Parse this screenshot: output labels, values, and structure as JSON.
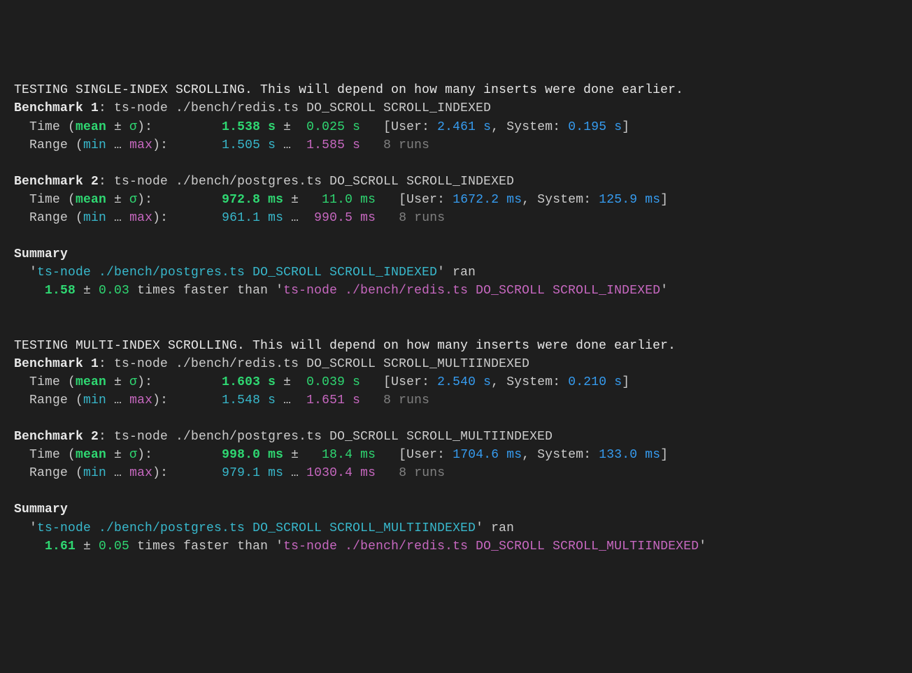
{
  "sections": [
    {
      "header": "TESTING SINGLE-INDEX SCROLLING. This will depend on how many inserts were done earlier.",
      "benchmarks": [
        {
          "label": "Benchmark 1",
          "cmd": "ts-node ./bench/redis.ts DO_SCROLL SCROLL_INDEXED",
          "mean": "1.538",
          "mean_unit": "s",
          "stddev": "0.025",
          "stddev_unit": "s",
          "user": "2.461",
          "user_unit": "s",
          "system": "0.195",
          "system_unit": "s",
          "min": "1.505",
          "min_unit": "s",
          "max": "1.585",
          "max_unit": "s",
          "runs": "8 runs"
        },
        {
          "label": "Benchmark 2",
          "cmd": "ts-node ./bench/postgres.ts DO_SCROLL SCROLL_INDEXED",
          "mean": "972.8",
          "mean_unit": "ms",
          "stddev": "11.0",
          "stddev_unit": "ms",
          "user": "1672.2",
          "user_unit": "ms",
          "system": "125.9",
          "system_unit": "ms",
          "min": "961.1",
          "min_unit": "ms",
          "max": "990.5",
          "max_unit": "ms",
          "runs": "8 runs"
        }
      ],
      "summary": {
        "winner": "ts-node ./bench/postgres.ts DO_SCROLL SCROLL_INDEXED",
        "ran": " ran",
        "factor": "1.58",
        "factor_pm": "0.03",
        "loser": "ts-node ./bench/redis.ts DO_SCROLL SCROLL_INDEXED"
      }
    },
    {
      "header": "TESTING MULTI-INDEX SCROLLING. This will depend on how many inserts were done earlier.",
      "benchmarks": [
        {
          "label": "Benchmark 1",
          "cmd": "ts-node ./bench/redis.ts DO_SCROLL SCROLL_MULTIINDEXED",
          "mean": "1.603",
          "mean_unit": "s",
          "stddev": "0.039",
          "stddev_unit": "s",
          "user": "2.540",
          "user_unit": "s",
          "system": "0.210",
          "system_unit": "s",
          "min": "1.548",
          "min_unit": "s",
          "max": "1.651",
          "max_unit": "s",
          "runs": "8 runs"
        },
        {
          "label": "Benchmark 2",
          "cmd": "ts-node ./bench/postgres.ts DO_SCROLL SCROLL_MULTIINDEXED",
          "mean": "998.0",
          "mean_unit": "ms",
          "stddev": "18.4",
          "stddev_unit": "ms",
          "user": "1704.6",
          "user_unit": "ms",
          "system": "133.0",
          "system_unit": "ms",
          "min": "979.1",
          "min_unit": "ms",
          "max": "1030.4",
          "max_unit": "ms",
          "runs": "8 runs"
        }
      ],
      "summary": {
        "winner": "ts-node ./bench/postgres.ts DO_SCROLL SCROLL_MULTIINDEXED",
        "ran": " ran",
        "factor": "1.61",
        "factor_pm": "0.05",
        "loser": "ts-node ./bench/redis.ts DO_SCROLL SCROLL_MULTIINDEXED"
      }
    }
  ],
  "labels": {
    "time": "Time",
    "mean": "mean",
    "sigma": "σ",
    "range": "Range",
    "min": "min",
    "max": "max",
    "user": "User",
    "system": "System",
    "summary": "Summary",
    "faster": " times faster than "
  }
}
